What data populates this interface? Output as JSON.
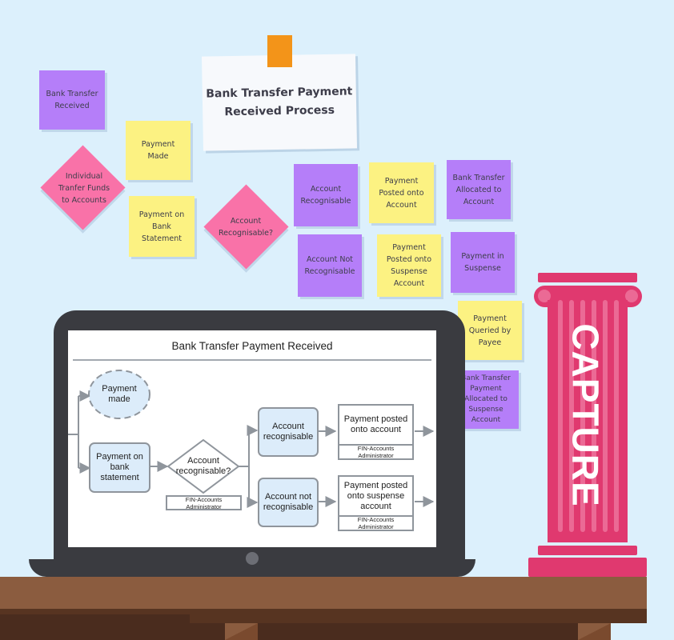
{
  "title_card": {
    "line1": "Bank Transfer Payment",
    "line2": "Received Process"
  },
  "sticky_notes": [
    {
      "id": "bank-transfer-received",
      "color": "purple",
      "lines": [
        "Bank Transfer",
        "Received"
      ]
    },
    {
      "id": "payment-made",
      "color": "yellow",
      "lines": [
        "Payment",
        "Made"
      ]
    },
    {
      "id": "payment-on-bank-statement",
      "color": "yellow",
      "lines": [
        "Payment on",
        "Bank",
        "Statement"
      ]
    },
    {
      "id": "account-recognisable",
      "color": "purple",
      "lines": [
        "Account",
        "Recognisable"
      ]
    },
    {
      "id": "payment-posted-onto-account",
      "color": "yellow",
      "lines": [
        "Payment",
        "Posted onto",
        "Account"
      ]
    },
    {
      "id": "bank-transfer-allocated-to-account",
      "color": "purple",
      "lines": [
        "Bank Transfer",
        "Allocated to",
        "Account"
      ]
    },
    {
      "id": "account-not-recognisable",
      "color": "purple",
      "lines": [
        "Account Not",
        "Recognisable"
      ]
    },
    {
      "id": "payment-posted-onto-suspense-account",
      "color": "yellow",
      "lines": [
        "Payment",
        "Posted onto",
        "Suspense",
        "Account"
      ]
    },
    {
      "id": "payment-in-suspense",
      "color": "purple",
      "lines": [
        "Payment in",
        "Suspense"
      ]
    },
    {
      "id": "payment-queried-by-payee",
      "color": "yellow",
      "lines": [
        "Payment",
        "Queried by",
        "Payee"
      ]
    },
    {
      "id": "bank-transfer-payment-allocated-to-suspense-account",
      "color": "purple",
      "lines": [
        "Bank Transfer",
        "Payment",
        "Allocated to",
        "Suspense",
        "Account"
      ]
    }
  ],
  "diamond_notes": [
    {
      "id": "individual-transfer-funds",
      "lines": [
        "Individual",
        "Tranfer Funds",
        "to Accounts"
      ]
    },
    {
      "id": "account-recognisable-question",
      "lines": [
        "Account",
        "Recognisable?"
      ]
    }
  ],
  "flowchart": {
    "title": "Bank Transfer Payment Received",
    "nodes": {
      "payment_made": [
        "Payment",
        "made"
      ],
      "payment_on_bank_statement": [
        "Payment on",
        "bank",
        "statement"
      ],
      "decision": [
        "Account",
        "recognisable?"
      ],
      "decision_role": [
        "FIN-Accounts",
        "Administrator"
      ],
      "account_recognisable": [
        "Account",
        "recognisable"
      ],
      "account_not_recognisable": [
        "Account not",
        "recognisable"
      ],
      "posted_onto_account": [
        "Payment posted",
        "onto account"
      ],
      "posted_onto_account_role": [
        "FIN-Accounts",
        "Administrator"
      ],
      "posted_onto_suspense": [
        "Payment posted",
        "onto suspense",
        "account"
      ],
      "posted_onto_suspense_role": [
        "FIN-Accounts",
        "Administrator"
      ]
    }
  },
  "pillar": {
    "label": "CAPTURE"
  },
  "colors": {
    "background": "#dcf0fc",
    "sticky_purple": "#b57ef9",
    "sticky_yellow": "#fcf282",
    "sticky_pink": "#f972a8",
    "tape": "#f39419",
    "pillar": "#e0396f",
    "laptop": "#3a3b40",
    "desk": "#8b5c3f",
    "flow_node_fill": "#dcecfa",
    "flow_stroke": "#8f959c"
  }
}
